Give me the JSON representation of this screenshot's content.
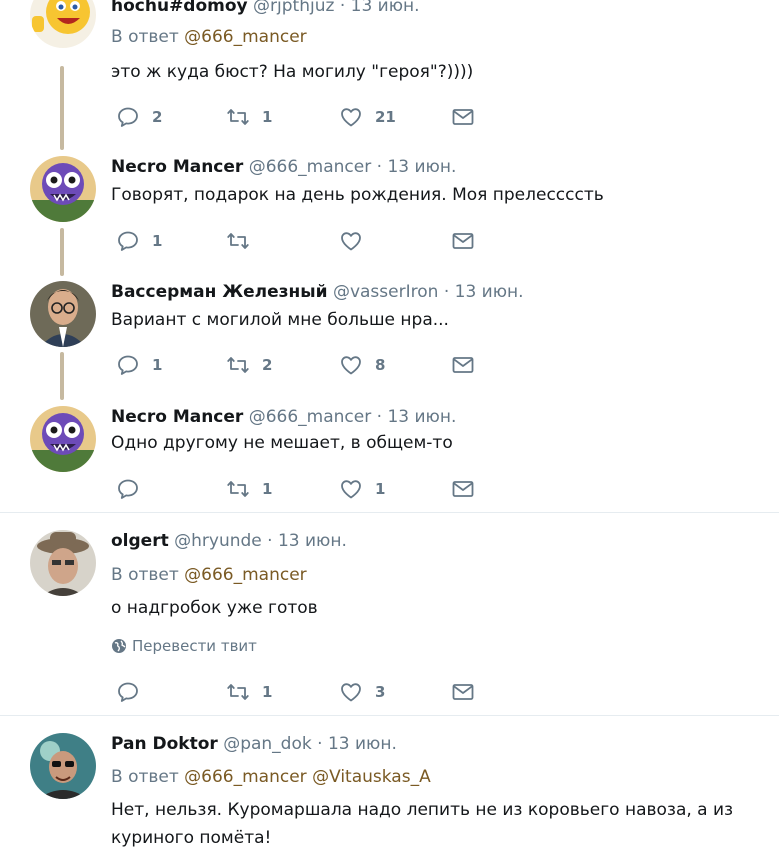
{
  "tweets": [
    {
      "name": "hochu#domoy",
      "handle": "@rjpthjuz",
      "dot": "·",
      "time": "13 июн.",
      "reply_prefix": "В ответ",
      "reply_mentions": "@666_mancer",
      "text": "это ж куда бюст? На могилу \"героя\"?))))",
      "counts": {
        "reply": "2",
        "retweet": "1",
        "like": "21"
      }
    },
    {
      "name": "Necro Mancer",
      "handle": "@666_mancer",
      "dot": "·",
      "time": "13 июн.",
      "text": "Говорят, подарок на день рождения. Моя прелессссть",
      "counts": {
        "reply": "1",
        "retweet": "",
        "like": ""
      }
    },
    {
      "name": "Вассерман Железный",
      "handle": "@vasserIron",
      "dot": "·",
      "time": "13 июн.",
      "text": "Вариант с могилой мне больше нра...",
      "counts": {
        "reply": "1",
        "retweet": "2",
        "like": "8"
      }
    },
    {
      "name": "Necro Mancer",
      "handle": "@666_mancer",
      "dot": "·",
      "time": "13 июн.",
      "text": "Одно другому не мешает, в общем-то",
      "counts": {
        "reply": "",
        "retweet": "1",
        "like": "1"
      }
    },
    {
      "name": "olgert",
      "handle": "@hryunde",
      "dot": "·",
      "time": "13 июн.",
      "reply_prefix": "В ответ",
      "reply_mentions": "@666_mancer",
      "text": "о надгробок уже готов",
      "translate": "Перевести твит",
      "counts": {
        "reply": "",
        "retweet": "1",
        "like": "3"
      }
    },
    {
      "name": "Pan Doktor",
      "handle": "@pan_dok",
      "dot": "·",
      "time": "13 июн.",
      "reply_prefix": "В ответ",
      "reply_mentions": "@666_mancer @Vitauskas_A",
      "text_line1": "Нет, нельзя. Куромаршала надо лепить не из коровьего навоза, а из",
      "text_line2": "куриного помёта!"
    }
  ],
  "icons": {
    "reply": "reply-icon",
    "retweet": "retweet-icon",
    "like": "heart-icon",
    "dm": "envelope-icon",
    "translate": "globe-icon"
  },
  "colors": {
    "name": "#14171a",
    "muted": "#657786",
    "mention": "#7a5a24",
    "thread_line": "#c6b9a0",
    "divider": "#e6ecf0"
  }
}
